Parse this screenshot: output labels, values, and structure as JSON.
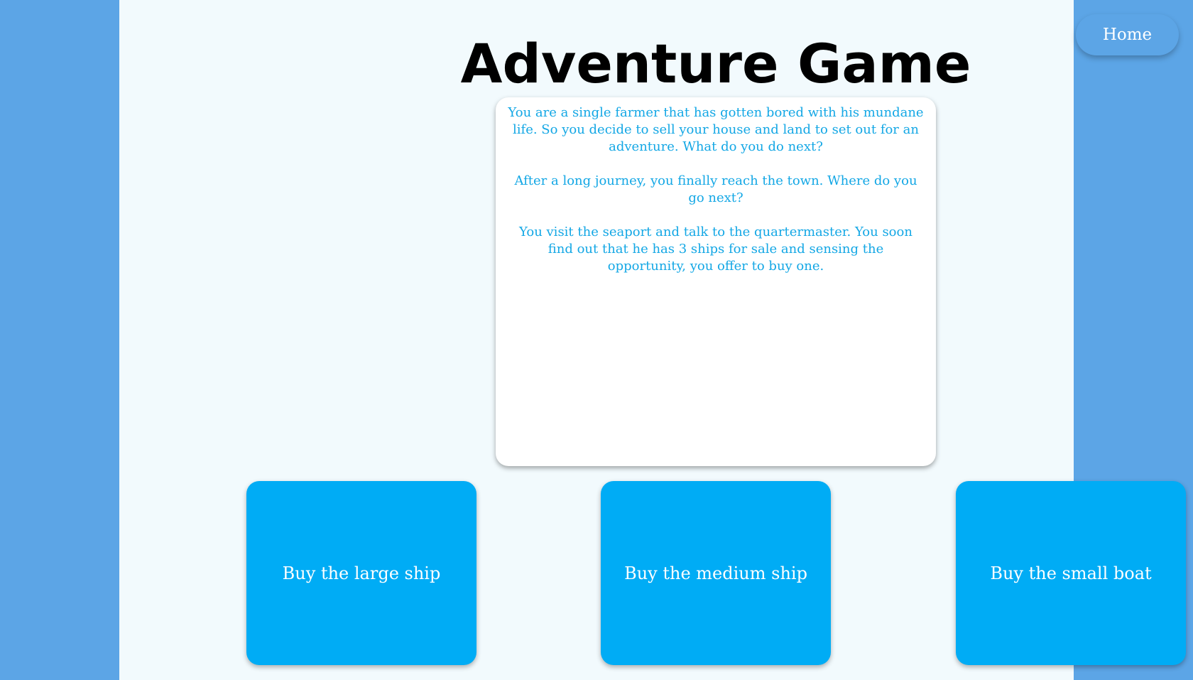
{
  "header": {
    "title": "Adventure Game",
    "home_label": "Home"
  },
  "story": {
    "paragraphs": [
      "You are a single farmer that has gotten bored with his mundane life. So you decide to sell your house and land to set out for an adventure. What do you do next?",
      "After a long journey, you finally reach the town. Where do you go next?",
      "You visit the seaport and talk to the quartermaster. You soon find out that he has 3 ships for sale and sensing the opportunity, you offer to buy one."
    ]
  },
  "choices": [
    {
      "label": "Buy the large ship"
    },
    {
      "label": "Buy the medium ship"
    },
    {
      "label": "Buy the small boat"
    }
  ],
  "colors": {
    "side_background": "#5ca5e6",
    "page_background": "#f2fafd",
    "home_button": "#5ca5e6",
    "choice_button": "#00acf5",
    "story_text": "#13a7e5"
  }
}
